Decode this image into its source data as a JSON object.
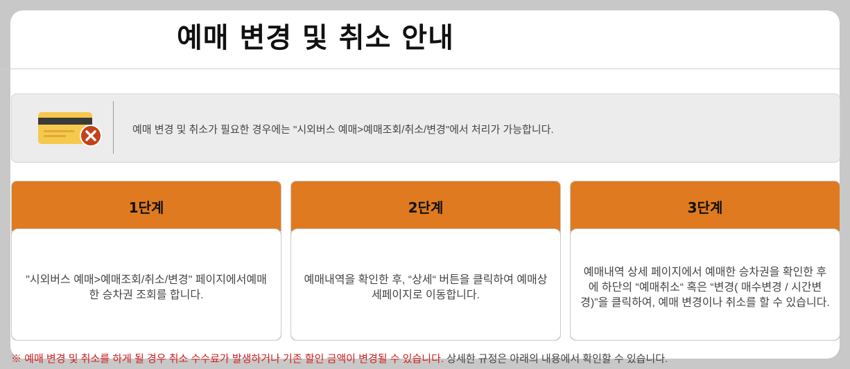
{
  "header": {
    "title": "예매 변경 및 취소 안내"
  },
  "info": {
    "icon": "card-cancel-icon",
    "text": "예매 변경 및 취소가 필요한 경우에는 \"시외버스 예매>예매조회/취소/변경\"에서 처리가 가능합니다."
  },
  "steps": [
    {
      "title": "1단계",
      "text": "\"시외버스 예매>예매조회/취소/변경\" 페이지에서예매한 승차권 조회를 합니다."
    },
    {
      "title": "2단계",
      "text": "예매내역을 확인한 후, “상세“ 버튼을 클릭하여 예매상세페이지로 이동합니다."
    },
    {
      "title": "3단계",
      "text": "예매내역 상세 페이지에서 예매한 승차권을 확인한 후에 하단의 “예매취소“ 혹은 “변경( 매수변경 / 시간변경)”을 클릭하여, 예매 변경이나 취소를 할 수 있습니다."
    }
  ],
  "footnote": {
    "warning": "※ 예매 변경 및 취소를 하게 될 경우 취소 수수료가 발생하거나 기존 할인 금액이 변경될 수 있습니다.",
    "info": " 상세한 규정은 아래의 내용에서 확인할 수 있습니다."
  },
  "colors": {
    "accent": "#e07a20",
    "warning": "#d02020",
    "background": "#c8c8c8"
  }
}
